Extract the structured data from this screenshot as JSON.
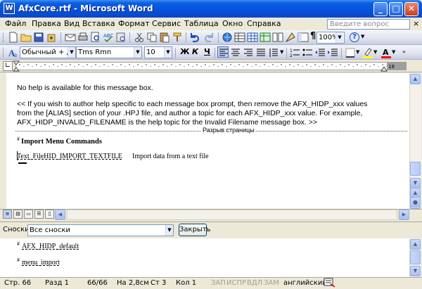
{
  "window": {
    "title": "AfxCore.rtf - Microsoft Word",
    "app_icon_letter": "W",
    "minimize": "_",
    "maximize": "□",
    "close": "✕"
  },
  "menu": {
    "items": [
      "Файл",
      "Правка",
      "Вид",
      "Вставка",
      "Формат",
      "Сервис",
      "Таблица",
      "Окно",
      "Справка"
    ],
    "help_placeholder": "Введите вопрос",
    "close_glyph": "×"
  },
  "standard_toolbar": {
    "zoom": "100%",
    "help_glyph": "?"
  },
  "format_toolbar": {
    "style": "Обычный + дво",
    "font": "Tms Rmn",
    "size": "10",
    "bold": "Ж",
    "italic": "К",
    "underline": "Ч",
    "highlight_color": "#ffff00",
    "font_color": "#ff0000"
  },
  "document": {
    "line1": "No help is available for this message box.",
    "para_line1": "<< If you wish to author help specific to each message box prompt, then remove the AFX_HIDP_xxx values",
    "para_line2": "from the [ALIAS] section of your .HPJ file, and author a topic for each AFX_HIDP_xxx value.  For example,",
    "para_line3": "AFX_HIDP_INVALID_FILENAME is the help topic for the Invalid Filename message box. >>",
    "page_break": "Разрыв страницы",
    "heading_mark": "#",
    "heading": "Import Menu Commands",
    "entry_code": "Text_FileHID_IMPORT_TEXTFILE",
    "entry_desc": "Import data from a text file"
  },
  "footnote_pane": {
    "label": "Сноски",
    "selection": "Все сноски",
    "close_button": "Закрыть",
    "note1_mark": "#",
    "note1": "AFX_HIDP_default",
    "note2_mark": "#",
    "note2": "menu_import"
  },
  "statusbar": {
    "page": "Стр.  66",
    "section": "Разд  1",
    "pages": "66/66",
    "position": "На 2,8см",
    "line": "Ст  3",
    "column": "Кол  1",
    "rec": "ЗАП",
    "trk": "ИСПР",
    "ext": "ВДЛ",
    "ovr": "ЗАМ",
    "language": "английский"
  }
}
